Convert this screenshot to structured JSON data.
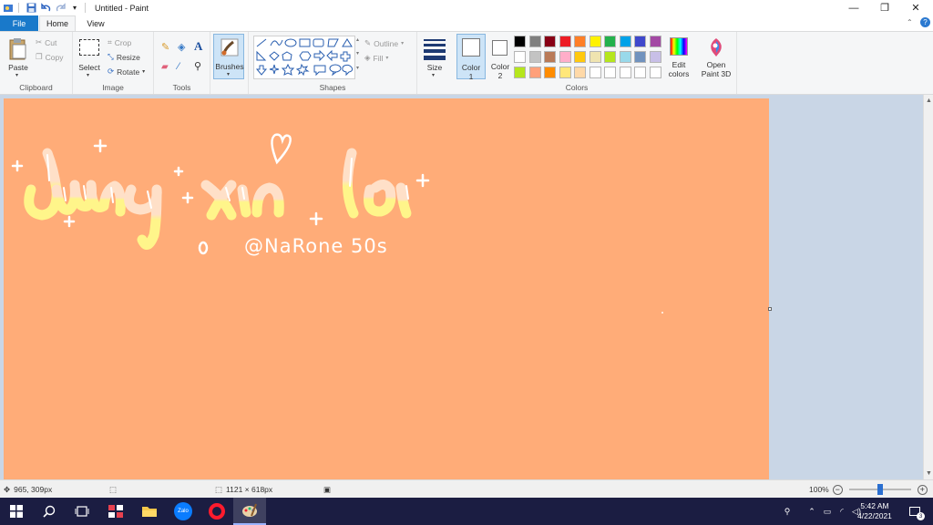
{
  "window": {
    "title": "Untitled - Paint",
    "minimize": "—",
    "restore": "❐",
    "close": "✕",
    "help": "?"
  },
  "tabs": [
    {
      "label": "File"
    },
    {
      "label": "Home"
    },
    {
      "label": "View"
    }
  ],
  "ribbon": {
    "clipboard": {
      "group_label": "Clipboard",
      "paste": "Paste",
      "cut": "Cut",
      "copy": "Copy"
    },
    "image": {
      "group_label": "Image",
      "select": "Select",
      "crop": "Crop",
      "resize": "Resize",
      "rotate": "Rotate"
    },
    "tools": {
      "group_label": "Tools"
    },
    "brushes": {
      "label": "Brushes"
    },
    "shapes": {
      "group_label": "Shapes",
      "outline": "Outline",
      "fill": "Fill"
    },
    "size": {
      "label": "Size"
    },
    "color1": {
      "label": "Color",
      "num": "1",
      "value": "#ffffff"
    },
    "color2": {
      "label": "Color",
      "num": "2",
      "value": "#ffffff"
    },
    "colors": {
      "group_label": "Colors",
      "row1": [
        "#000000",
        "#7f7f7f",
        "#880015",
        "#ed1c24",
        "#ff7f27",
        "#fff200",
        "#22b14c",
        "#00a2e8",
        "#3f48cc",
        "#a349a4"
      ],
      "row2": [
        "#ffffff",
        "#c3c3c3",
        "#b97a57",
        "#ffaec9",
        "#ffc90e",
        "#efe4b0",
        "#b5e61d",
        "#99d9ea",
        "#7092be",
        "#c8bfe7"
      ],
      "row3": [
        "#b5e61d",
        "#ffa07a",
        "#ff8c00",
        "#ffe77a",
        "#ffd9a8",
        "#ffffff",
        "#ffffff",
        "#ffffff",
        "#ffffff",
        "#ffffff"
      ]
    },
    "edit_colors": {
      "line1": "Edit",
      "line2": "colors"
    },
    "paint3d": {
      "line1": "Open",
      "line2": "Paint 3D"
    }
  },
  "canvas": {
    "background": "#ffac78",
    "handwriting": "dùng xin lỗi",
    "signature": "@NaRone 50s"
  },
  "status": {
    "cursor_pos": "965, 309px",
    "image_size": "1121 × 618px",
    "zoom": "100%",
    "zoom_level": 0.5
  },
  "taskbar": {
    "time": "5:42 AM",
    "date": "4/22/2021",
    "notifications": "3",
    "zalo_label": "Zalo"
  }
}
